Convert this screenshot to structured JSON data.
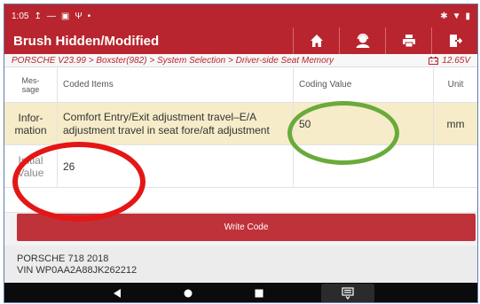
{
  "statusbar": {
    "time": "1:05",
    "icons_left": [
      "upload-icon",
      "minus-icon",
      "image-icon",
      "usb-icon",
      "dot-icon"
    ],
    "icons_right": [
      "bluetooth-icon",
      "wifi-icon",
      "battery-icon"
    ]
  },
  "header": {
    "title": "Brush Hidden/Modified",
    "buttons": [
      "home-icon",
      "user-support-icon",
      "print-icon",
      "exit-icon"
    ]
  },
  "breadcrumb": {
    "path": "PORSCHE V23.99 > Boxster(982) > System Selection > Driver-side Seat Memory",
    "voltage": "12.65V"
  },
  "table": {
    "columns": {
      "message": "Mes-\nsage",
      "coded_items": "Coded Items",
      "coding_value": "Coding Value",
      "unit": "Unit"
    },
    "rows": [
      {
        "message": "Infor-\nmation",
        "item": "Comfort Entry/Exit adjustment travel–E/A adjustment travel in seat fore/aft adjustment",
        "value": "50",
        "unit": "mm"
      },
      {
        "message": "Initial\nValue",
        "item": "26",
        "value": "",
        "unit": ""
      }
    ]
  },
  "actions": {
    "write_code": "Write Code"
  },
  "vehicle": {
    "model": "PORSCHE 718 2018",
    "vin": "VIN WP0AA2A88JK262212"
  },
  "colors": {
    "brand_red": "#b8252e",
    "highlight_row": "#f6ecc9",
    "annotation_green": "#6aaa3a",
    "annotation_red": "#e41616"
  }
}
